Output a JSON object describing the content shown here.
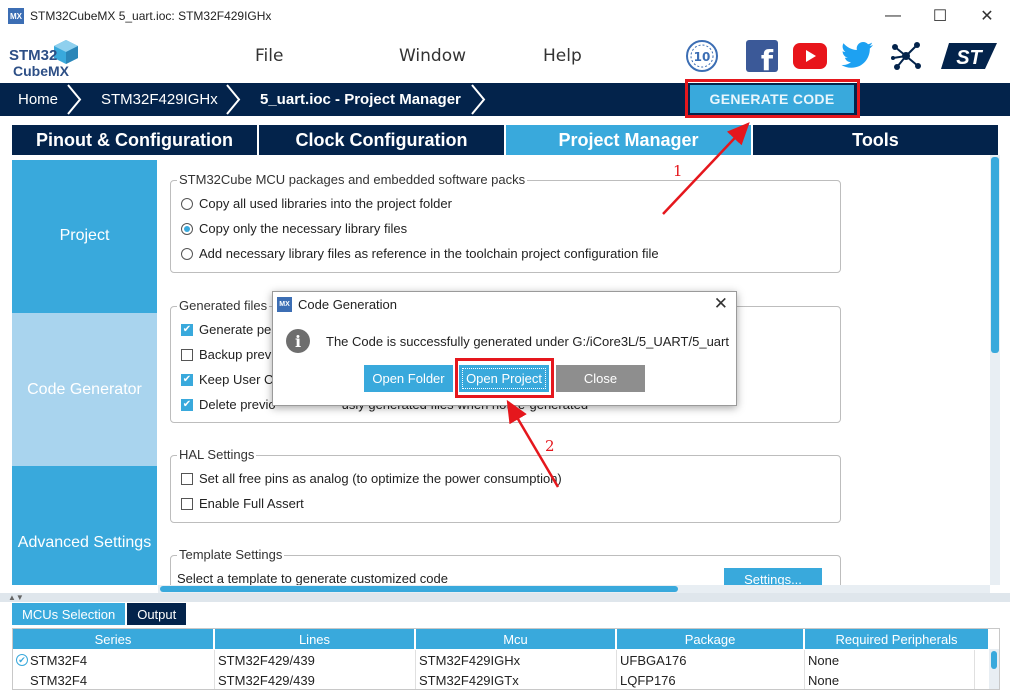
{
  "window": {
    "title": "STM32CubeMX 5_uart.ioc: STM32F429IGHx",
    "app_badge": "MX",
    "minimize": "—",
    "maximize": "☐",
    "close": "✕"
  },
  "brand": {
    "line1": "STM32",
    "line2": "CubeMX"
  },
  "menu": {
    "file": "File",
    "window": "Window",
    "help": "Help"
  },
  "social": {
    "anniversary": "10",
    "facebook": "f",
    "st_logo": "ST"
  },
  "breadcrumb": {
    "home": "Home",
    "mcu": "STM32F429IGHx",
    "project": "5_uart.ioc - Project Manager"
  },
  "generate_button": "GENERATE CODE",
  "tabs": {
    "pinout": "Pinout & Configuration",
    "clock": "Clock Configuration",
    "project_manager": "Project Manager",
    "tools": "Tools"
  },
  "side": {
    "project": "Project",
    "code_generator": "Code Generator",
    "advanced": "Advanced Settings"
  },
  "packages": {
    "title": "STM32Cube MCU packages and embedded software packs",
    "opt1": "Copy all used libraries into the project folder",
    "opt2": "Copy only the necessary library files",
    "opt3": "Add necessary library files as reference in the toolchain project configuration file"
  },
  "generated": {
    "title": "Generated files",
    "opt1": "Generate per",
    "opt2": "Backup previ",
    "opt3": "Keep User C",
    "opt4_a": "Delete previo",
    "opt4_b": "usly generated files when not re-generate",
    "opt4_c": "d"
  },
  "hal": {
    "title": "HAL Settings",
    "opt1": "Set all free pins as analog (to optimize the power consumption)",
    "opt2": "Enable Full Assert"
  },
  "template": {
    "title": "Template Settings",
    "desc": "Select a template to generate customized code",
    "button": "Settings..."
  },
  "bottom_tabs": {
    "mcus": "MCUs Selection",
    "output": "Output"
  },
  "table": {
    "columns": [
      "Series",
      "Lines",
      "Mcu",
      "Package",
      "Required Peripherals"
    ],
    "rows": [
      [
        "STM32F4",
        "STM32F429/439",
        "STM32F429IGHx",
        "UFBGA176",
        "None"
      ],
      [
        "STM32F4",
        "STM32F429/439",
        "STM32F429IGTx",
        "LQFP176",
        "None"
      ]
    ]
  },
  "dialog": {
    "badge": "MX",
    "title": "Code Generation",
    "message": "The Code is successfully generated under G:/iCore3L/5_UART/5_uart",
    "open_folder": "Open Folder",
    "open_project": "Open Project",
    "close": "Close",
    "close_x": "✕"
  },
  "annotations": {
    "one": "1",
    "two": "2"
  },
  "colors": {
    "navy": "#03234b",
    "accent": "#39a9dc",
    "red": "#e5171d"
  }
}
